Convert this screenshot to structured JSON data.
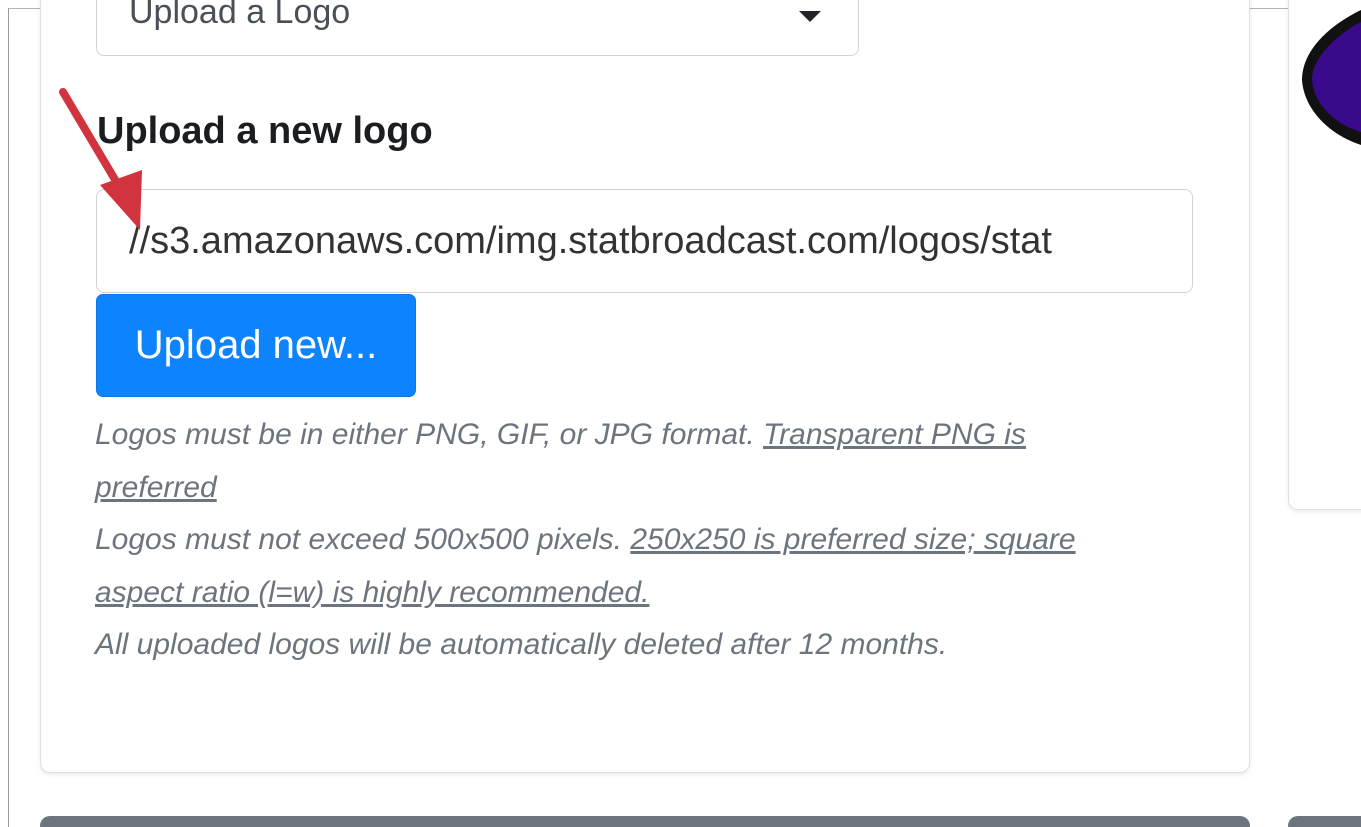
{
  "logo_select": {
    "selected": "Upload a Logo"
  },
  "upload_section": {
    "heading": "Upload a new logo",
    "url_value": "//s3.amazonaws.com/img.statbroadcast.com/logos/stat",
    "upload_button_label": "Upload new..."
  },
  "help_text": {
    "format_line": "Logos must be in either PNG, GIF, or JPG format. ",
    "format_link_part1": "Transparent PNG is",
    "format_link_part2": "preferred",
    "size_line": "Logos must not exceed 500x500 pixels. ",
    "size_link_part1": "250x250 is preferred size; square",
    "size_link_part2": "aspect ratio (l=w) is highly recommended.",
    "retention_line": "All uploaded logos will be automatically deleted after 12 months."
  },
  "colors": {
    "primary_button": "#0d83fd",
    "annotation_arrow": "#d1343f",
    "side_logo": "#3a0a8c"
  }
}
